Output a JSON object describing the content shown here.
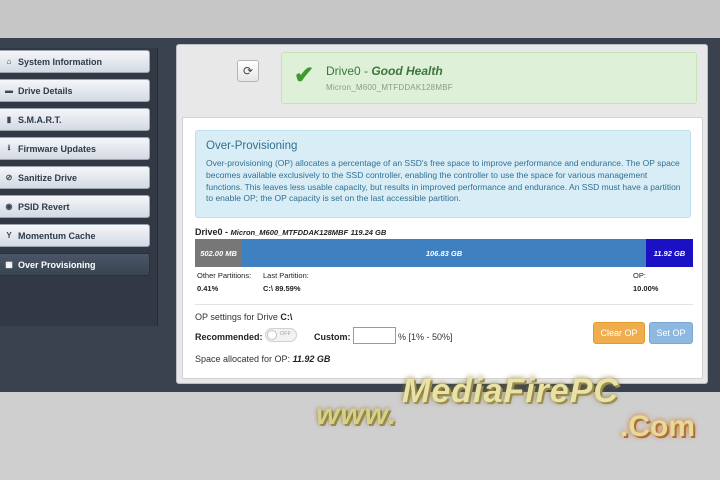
{
  "sidebar": {
    "items": [
      {
        "label": "System Information",
        "icon": "home-icon",
        "glyph": "⌂"
      },
      {
        "label": "Drive Details",
        "icon": "drive-icon",
        "glyph": "▬"
      },
      {
        "label": "S.M.A.R.T.",
        "icon": "bar-chart-icon",
        "glyph": "▮"
      },
      {
        "label": "Firmware Updates",
        "icon": "download-icon",
        "glyph": "⭳"
      },
      {
        "label": "Sanitize Drive",
        "icon": "ban-icon",
        "glyph": "⊘"
      },
      {
        "label": "PSID Revert",
        "icon": "eye-icon",
        "glyph": "◉"
      },
      {
        "label": "Momentum Cache",
        "icon": "filter-icon",
        "glyph": "Y"
      },
      {
        "label": "Over Provisioning",
        "icon": "grid-icon",
        "glyph": "▦",
        "active": true
      }
    ]
  },
  "header": {
    "refresh_glyph": "⟳",
    "health_check_glyph": "✔",
    "drive_name": "Drive0 - ",
    "health_status": "Good Health",
    "drive_model": "Micron_M600_MTFDDAK128MBF"
  },
  "info": {
    "title": "Over-Provisioning",
    "text": "Over-provisioning (OP) allocates a percentage of an SSD's free space to improve performance and endurance. The OP space becomes available exclusively to the SSD controller, enabling the controller to use the space for various management functions. This leaves less usable capacity, but results in improved performance and endurance. An SSD must have a partition to enable OP; the OP capacity is set on the last accessible partition."
  },
  "drive": {
    "name": "Drive0 - ",
    "model": "Micron_M600_MTFDDAK128MBF",
    "size": "119.24 GB"
  },
  "bar": {
    "segments": [
      {
        "label": "502.00 MB",
        "fraction": 0.0041,
        "color": "#777777"
      },
      {
        "label": "106.83 GB",
        "fraction": 0.8959,
        "color": "#3f80c0"
      },
      {
        "label": "11.92 GB",
        "fraction": 0.1,
        "color": "#1a10c4"
      }
    ]
  },
  "partitions": {
    "other_label": "Other Partitions:",
    "other_value": "0.41%",
    "last_label": "Last Partition:",
    "last_value": "C:\\ 89.59%",
    "op_label": "OP:",
    "op_value": "10.00%"
  },
  "op_settings": {
    "title": "OP settings for Drive ",
    "drive_letter": "C:\\",
    "recommended_label": "Recommended:",
    "toggle_text": "OFF",
    "custom_label": "Custom:",
    "custom_value": "",
    "range_hint": "% [1% - 50%]",
    "clear_button": "Clear OP",
    "set_button": "Set OP",
    "allocated_label": "Space allocated for OP: ",
    "allocated_value": "11.92 GB"
  },
  "watermark": {
    "www": "www.",
    "name": "MediaFirePC",
    "com": ".Com"
  }
}
